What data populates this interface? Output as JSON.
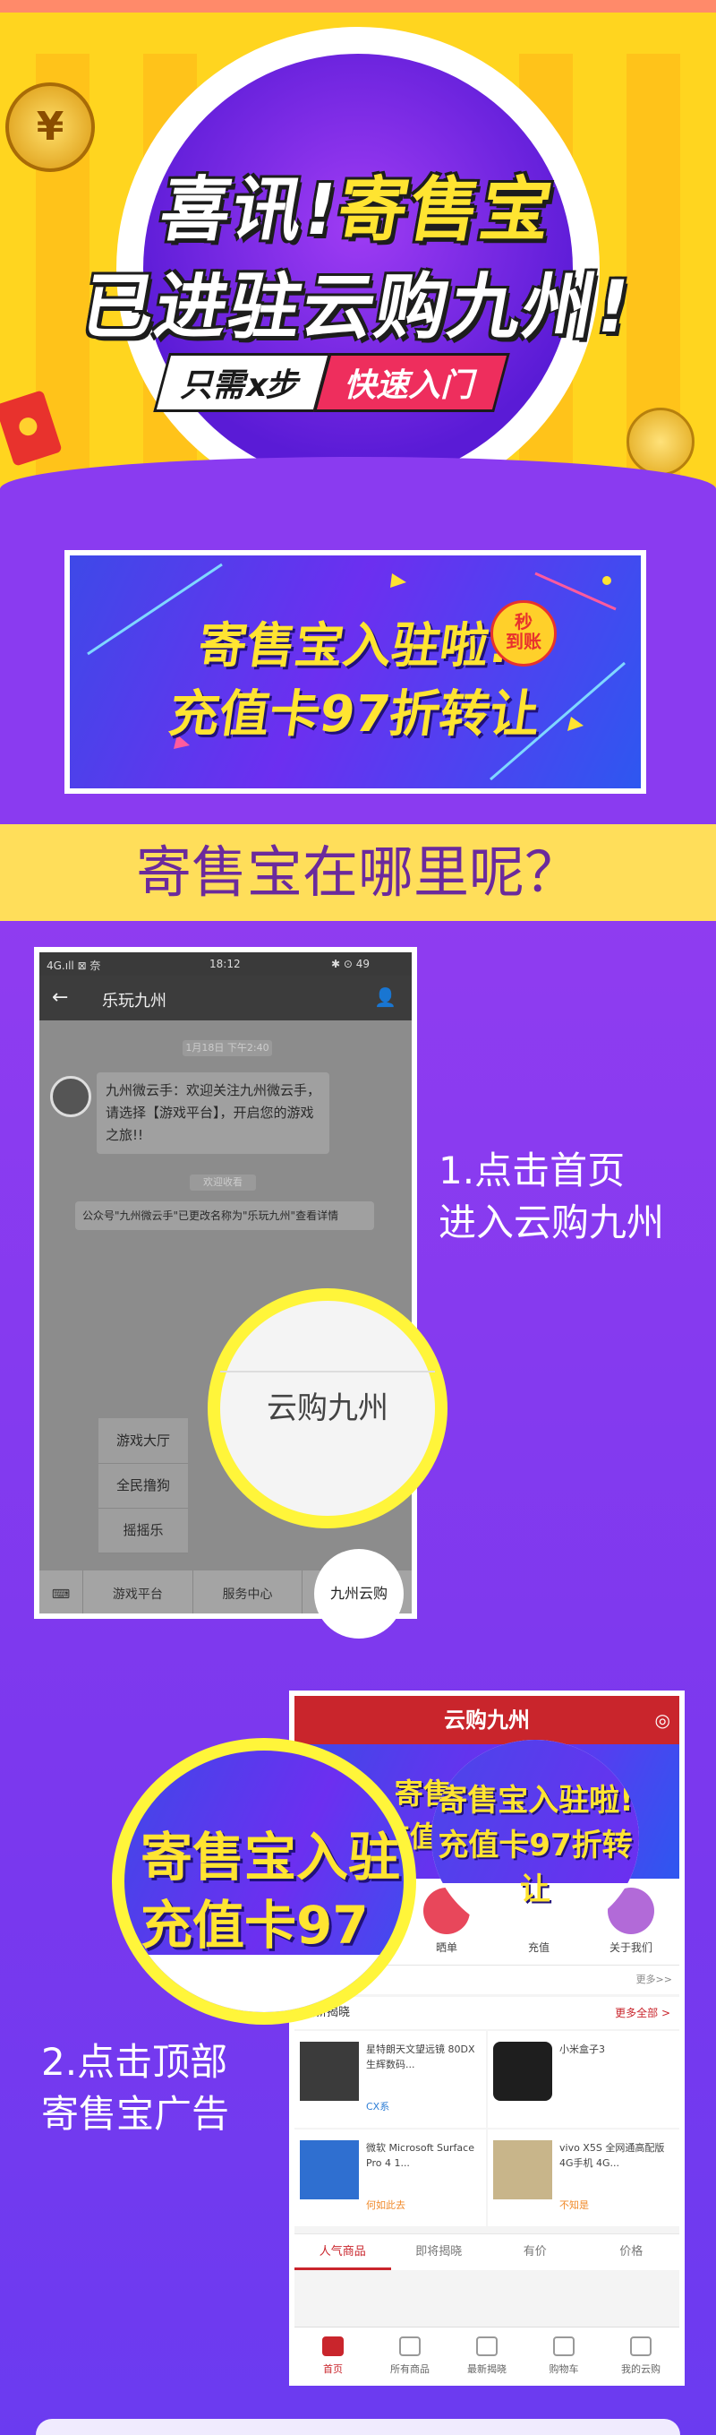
{
  "hero": {
    "coin_symbol": "¥",
    "headline_a": "喜讯!",
    "headline_b": "寄售宝",
    "headline_line2": "已进驻云购九州!",
    "steps_left": "只需x步",
    "steps_right": "快速入门"
  },
  "banner": {
    "line1": "寄售宝入驻啦!",
    "line2": "充值卡97折转让",
    "badge_top": "秒",
    "badge_bottom": "到账"
  },
  "question": "寄售宝在哪里呢？",
  "step1": {
    "label_line1": "1.点击首页",
    "label_line2": "进入云购九州"
  },
  "phone1": {
    "status_left": "4G.ıll ⊠ 奈",
    "status_time": "18:12",
    "status_right": "✱ ⊙ 49",
    "title": "乐玩九州",
    "time_tag": "1月18日 下午2:40",
    "message": "九州微云手：欢迎关注九州微云手，请选择【游戏平台】，开启您的游戏之旅!!",
    "system_tag": "欢迎收看",
    "system_notice": "公众号\"九州微云手\"已更改名称为\"乐玩九州\"查看详情",
    "menu": [
      "游戏大厅",
      "全民撸狗",
      "摇摇乐"
    ],
    "tabs": [
      "游戏平台",
      "服务中心",
      "九州云购"
    ],
    "magnified": "云购九州"
  },
  "step2": {
    "label_line1": "2.点击顶部",
    "label_line2": "寄售宝广告"
  },
  "phone2": {
    "title": "云购九州",
    "banner_line1": "寄售宝入驻啦!",
    "banner_line2": "充值卡97折转让",
    "icons": [
      "晒单",
      "充值",
      "关于我们"
    ],
    "more": "更多>>",
    "latest_title": "最新揭晓",
    "latest_more": "更多全部 >",
    "products": [
      {
        "title": "星特朗天文望远镜 80DX 生辉数码...",
        "tag": "CX系"
      },
      {
        "title": "小米盒子3",
        "tag": ""
      },
      {
        "title": "微软 Microsoft Surface Pro 4 1...",
        "tag": "何如此去"
      },
      {
        "title": "vivo X5S 全网通高配版4G手机 4G...",
        "tag": "不知是"
      }
    ],
    "categories": [
      "人气商品",
      "即将揭晓",
      "有价",
      "价格"
    ],
    "bottom_tabs": [
      "首页",
      "所有商品",
      "最新揭晓",
      "购物车",
      "我的云购"
    ]
  },
  "magnifier2": {
    "line1": "寄售宝入驻",
    "line2": "充值卡97"
  },
  "colors": {
    "hero_yellow": "#ffd51f",
    "purple": "#8a3bf0",
    "headline_yellow": "#ffe431",
    "question_bg": "#ffde5a",
    "question_text": "#6b2a9c",
    "magnifier_ring": "#fff53a"
  }
}
